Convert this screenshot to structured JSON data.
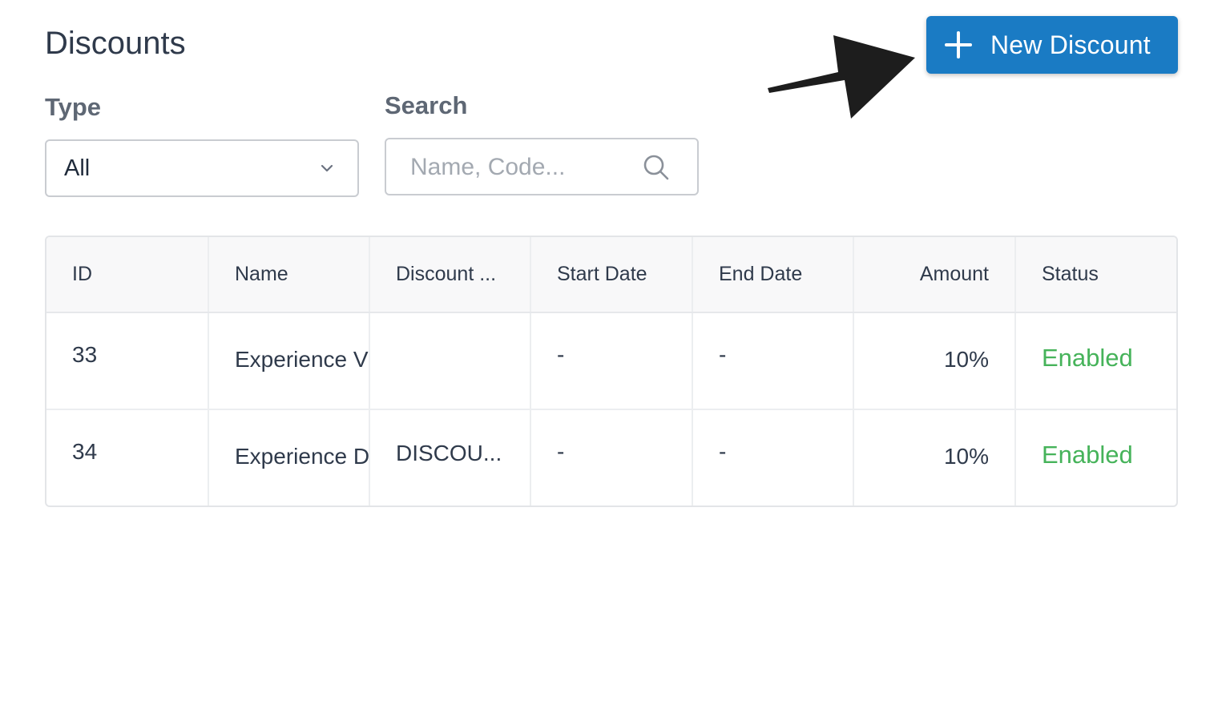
{
  "header": {
    "title": "Discounts",
    "new_button_label": "New Discount"
  },
  "filters": {
    "type_label": "Type",
    "type_value": "All",
    "search_label": "Search",
    "search_placeholder": "Name, Code..."
  },
  "table": {
    "columns": [
      "ID",
      "Name",
      "Discount ...",
      "Start Date",
      "End Date",
      "Amount",
      "Status"
    ],
    "rows": [
      {
        "id": "33",
        "name": "Experience V",
        "code": "",
        "start": "-",
        "end": "-",
        "amount": "10%",
        "status": "Enabled"
      },
      {
        "id": "34",
        "name": "Experience D",
        "code": "DISCOU...",
        "start": "-",
        "end": "-",
        "amount": "10%",
        "status": "Enabled"
      }
    ]
  },
  "colors": {
    "primary": "#1a7bc4",
    "status_enabled": "#46b35a",
    "text": "#2f3a4b",
    "label": "#5e6774"
  },
  "icons": {
    "new_button": "plus-icon",
    "select": "chevron-down-icon",
    "search": "search-icon",
    "annotation": "arrow-icon"
  }
}
